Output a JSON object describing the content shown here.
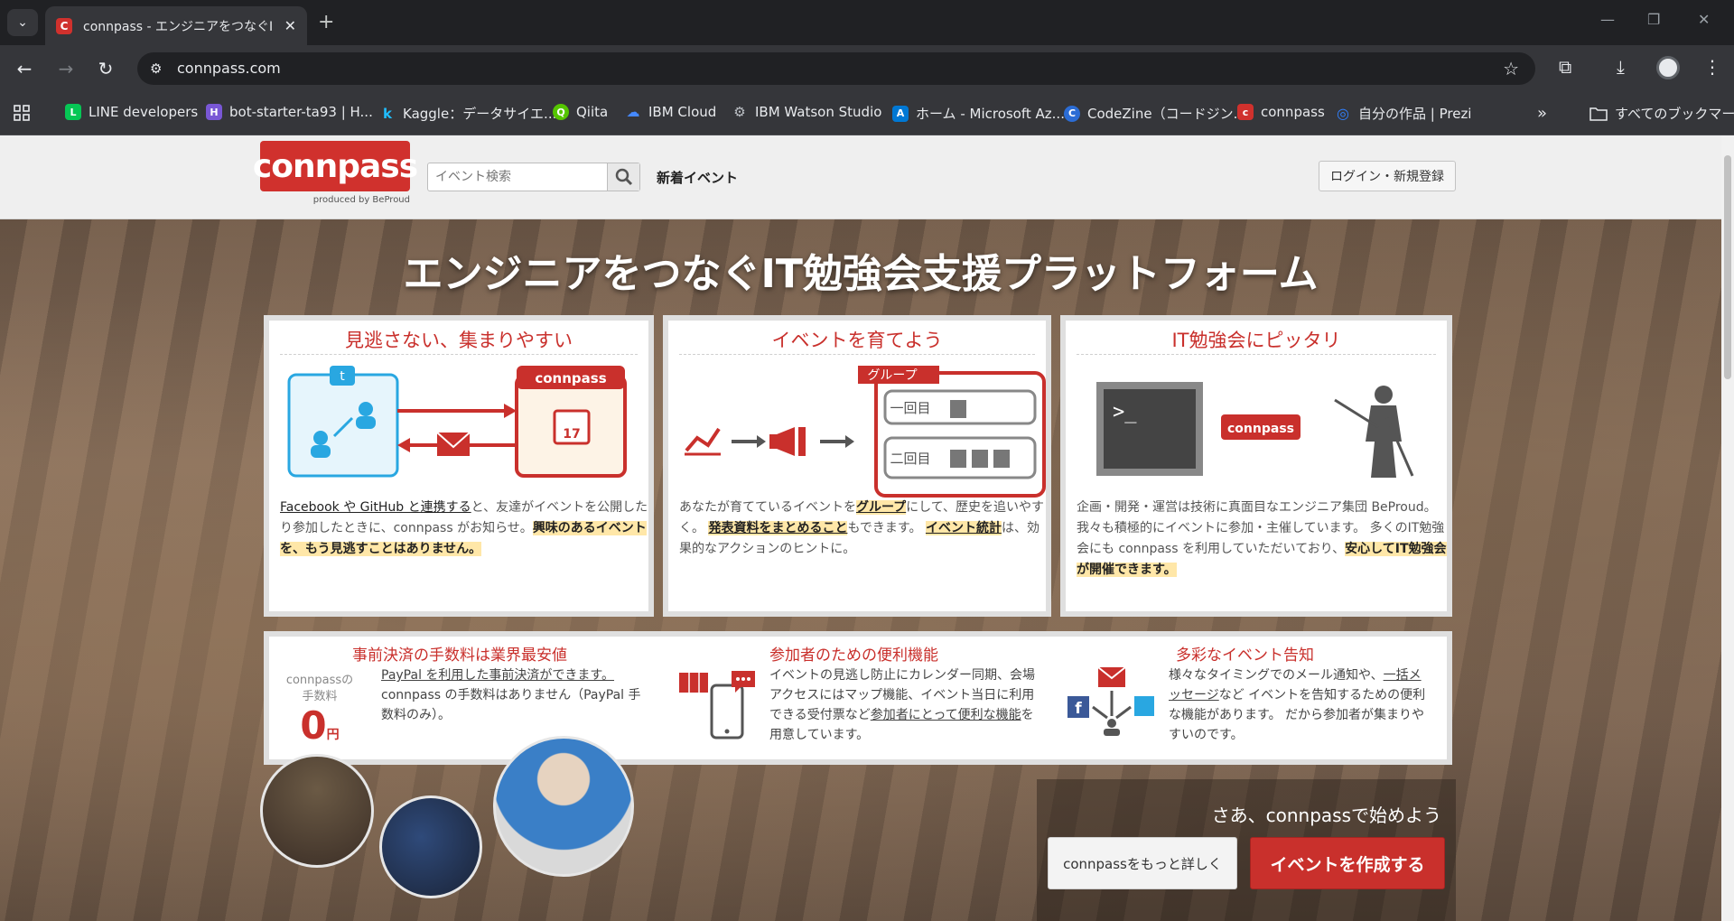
{
  "browser": {
    "tab_title": "connpass - エンジニアをつなぐIT勉強会支援プラットフォーム",
    "favicon_letter": "C",
    "url": "connpass.com",
    "bookmarks": [
      {
        "label": "LINE developers",
        "color": "#06c755",
        "letter": "L"
      },
      {
        "label": "bot-starter-ta93 | H...",
        "color": "#7957d5",
        "letter": "H"
      },
      {
        "label": "Kaggle：データサイエ...",
        "color": "#20beff",
        "letter": "k"
      },
      {
        "label": "Qiita",
        "color": "#55c500",
        "letter": "Q"
      },
      {
        "label": "IBM Cloud",
        "color": "#4589ff",
        "letter": "☁"
      },
      {
        "label": "IBM Watson Studio",
        "color": "#5f6368",
        "letter": "⚙"
      },
      {
        "label": "ホーム - Microsoft Az...",
        "color": "#0078d4",
        "letter": "A"
      },
      {
        "label": "CodeZine（コードジン...",
        "color": "#2b6cd4",
        "letter": "C"
      },
      {
        "label": "connpass",
        "color": "#d0312d",
        "letter": "c"
      },
      {
        "label": "自分の作品 | Prezi",
        "color": "#3181ff",
        "letter": "◎"
      }
    ],
    "all_bookmarks": "すべてのブックマーク"
  },
  "header": {
    "logo_text": "connpass",
    "logo_sub": "produced by BeProud",
    "search_placeholder": "イベント検索",
    "nav_new": "新着イベント",
    "login": "ログイン・新規登録"
  },
  "hero": {
    "title": "エンジニアをつなぐIT勉強会支援プラットフォーム"
  },
  "cards": [
    {
      "title": "見逃さない、集まりやすい",
      "link1": "Facebook や GitHub と連携する",
      "text1": "と、友達がイベントを公開したり参加したときに、connpass がお知らせ。",
      "highlight": "興味のあるイベントを、もう見逃すことはありません。",
      "illus_label": "connpass",
      "calendar_day": "17"
    },
    {
      "title": "イベントを育てよう",
      "text1": "あなたが育てているイベントを",
      "link1": "グループ",
      "text2": "にして、歴史を追いやすく。",
      "highlight1": "発表資料をまとめること",
      "text3": "もできます。",
      "highlight2": "イベント統計",
      "text4": "は、効果的なアクションのヒントに。",
      "group_label": "グループ",
      "row1": "一回目",
      "row2": "二回目"
    },
    {
      "title": "IT勉強会にピッタリ",
      "text1": "企画・開発・運営は技術に真面目なエンジニア集団 BeProud。 我々も積極的にイベントに参加・主催しています。 多くのIT勉強会にも connpass を利用していただいており、",
      "highlight": "安心してIT勉強会が開催できます。",
      "illus_label": "connpass"
    }
  ],
  "features": [
    {
      "title": "事前決済の手数料は業界最安値",
      "fee_label1": "connpassの",
      "fee_label2": "手数料",
      "fee_value": "0",
      "fee_unit": "円",
      "link": "PayPal を利用した事前決済ができます。",
      "text": "connpass の手数料はありません（PayPal 手数料のみ）。"
    },
    {
      "title": "参加者のための便利機能",
      "text1": "イベントの見逃し防止にカレンダー同期、会場アクセスにはマップ機能、イベント当日に利用できる受付票など",
      "link": "参加者にとって便利な機能",
      "text2": "を用意しています。"
    },
    {
      "title": "多彩なイベント告知",
      "text1": "様々なタイミングでのメール通知や、",
      "link": "一括メッセージ",
      "text2": "など イベントを告知するための便利な機能があります。 だから参加者が集まりやすいのです。"
    }
  ],
  "cta": {
    "text": "さあ、connpassで始めよう",
    "more": "connpassをもっと詳しく",
    "create": "イベントを作成する"
  },
  "colors": {
    "brand_red": "#c9302c",
    "highlight": "#ffe7a8"
  }
}
